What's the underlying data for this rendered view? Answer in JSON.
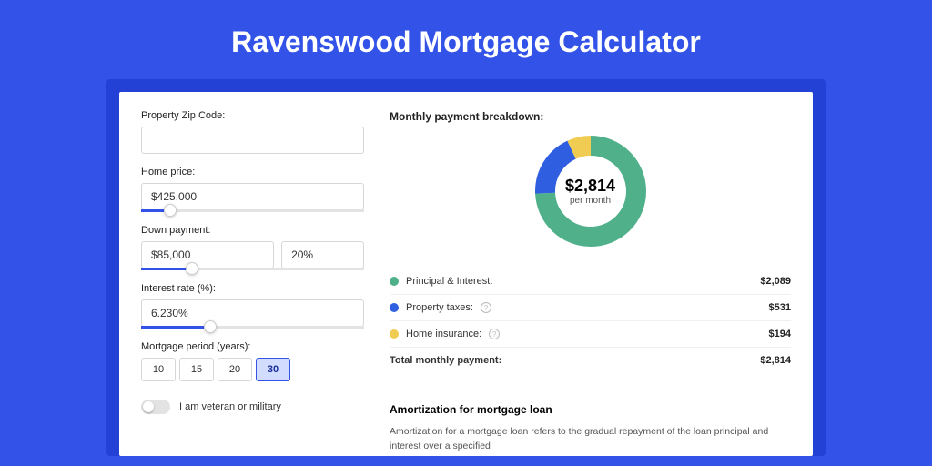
{
  "pageTitle": "Ravenswood Mortgage Calculator",
  "form": {
    "zip": {
      "label": "Property Zip Code:",
      "value": ""
    },
    "homePrice": {
      "label": "Home price:",
      "value": "$425,000",
      "sliderPct": 10
    },
    "downPayment": {
      "label": "Down payment:",
      "amount": "$85,000",
      "percent": "20%",
      "sliderPct": 20
    },
    "interest": {
      "label": "Interest rate (%):",
      "value": "6.230%",
      "sliderPct": 28
    },
    "period": {
      "label": "Mortgage period (years):",
      "options": [
        "10",
        "15",
        "20",
        "30"
      ],
      "selected": "30"
    },
    "veteran": {
      "label": "I am veteran or military",
      "checked": false
    }
  },
  "breakdown": {
    "title": "Monthly payment breakdown:",
    "centerValue": "$2,814",
    "centerLabel": "per month",
    "items": [
      {
        "label": "Principal & Interest:",
        "value": "$2,089",
        "color": "#4fb08a",
        "info": false
      },
      {
        "label": "Property taxes:",
        "value": "$531",
        "color": "#2f5ee0",
        "info": true
      },
      {
        "label": "Home insurance:",
        "value": "$194",
        "color": "#f0cd52",
        "info": true
      }
    ],
    "total": {
      "label": "Total monthly payment:",
      "value": "$2,814"
    }
  },
  "chart_data": {
    "type": "pie",
    "title": "Monthly payment breakdown",
    "series": [
      {
        "name": "Principal & Interest",
        "value": 2089,
        "color": "#4fb08a"
      },
      {
        "name": "Property taxes",
        "value": 531,
        "color": "#2f5ee0"
      },
      {
        "name": "Home insurance",
        "value": 194,
        "color": "#f0cd52"
      }
    ],
    "totalLabel": "per month",
    "totalValue": 2814
  },
  "amortization": {
    "title": "Amortization for mortgage loan",
    "text": "Amortization for a mortgage loan refers to the gradual repayment of the loan principal and interest over a specified"
  }
}
